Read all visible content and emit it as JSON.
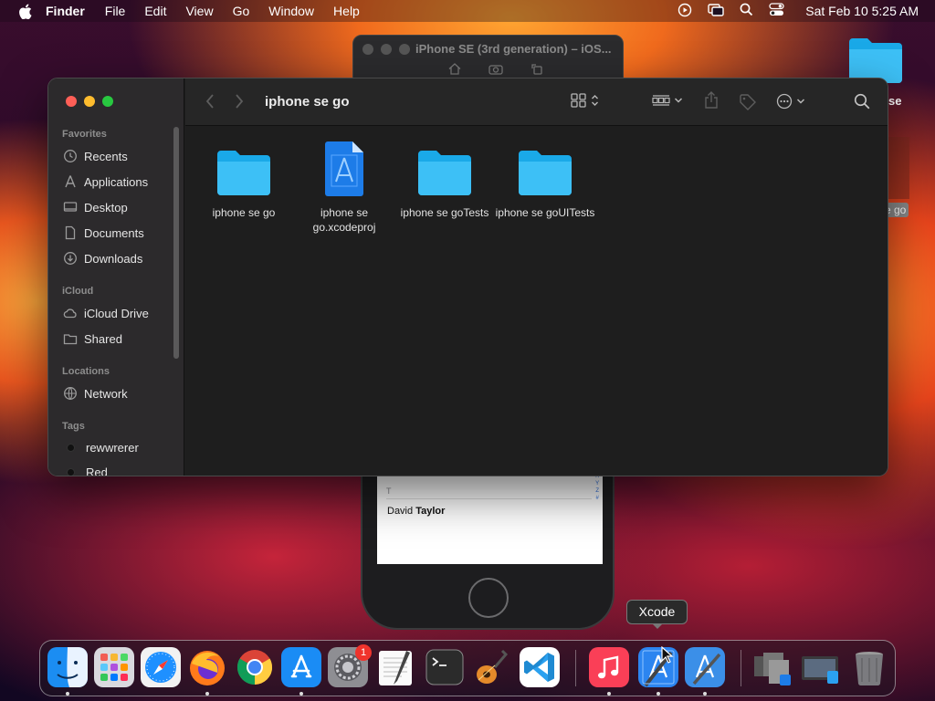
{
  "menubar": {
    "app_name": "Finder",
    "items": [
      "File",
      "Edit",
      "View",
      "Go",
      "Window",
      "Help"
    ],
    "clock": "Sat Feb 10  5:25 AM"
  },
  "simulator": {
    "title": "iPhone SE (3rd generation) – iOS...",
    "section_letter": "T",
    "contact_first": "David",
    "contact_last": "Taylor",
    "index_letters": "V\nW\nX\nY\nZ\n#"
  },
  "desktop": {
    "folder_label": "se",
    "ghost_label": "e go"
  },
  "finder": {
    "title": "iphone se go",
    "sidebar": {
      "favorites_header": "Favorites",
      "favorites": [
        "Recents",
        "Applications",
        "Desktop",
        "Documents",
        "Downloads"
      ],
      "icloud_header": "iCloud",
      "icloud": [
        "iCloud Drive",
        "Shared"
      ],
      "locations_header": "Locations",
      "locations": [
        "Network"
      ],
      "tags_header": "Tags",
      "tags": [
        "rewwrerer",
        "Red"
      ]
    },
    "files": [
      {
        "name": "iphone se go",
        "kind": "folder"
      },
      {
        "name": "iphone se go.xcodeproj",
        "kind": "xcodeproj"
      },
      {
        "name": "iphone se goTests",
        "kind": "folder"
      },
      {
        "name": "iphone se goUITests",
        "kind": "folder"
      }
    ]
  },
  "tooltip": "Xcode",
  "dock": {
    "apps": [
      "Finder",
      "Launchpad",
      "Safari",
      "Firefox",
      "Chrome",
      "App Store",
      "System Settings",
      "TextEdit",
      "Terminal",
      "GarageBand",
      "Visual Studio Code",
      "Music",
      "Xcode",
      "Xcode-beta",
      "Downloads stack",
      "Documents stack",
      "Trash"
    ],
    "settings_badge": "1"
  }
}
